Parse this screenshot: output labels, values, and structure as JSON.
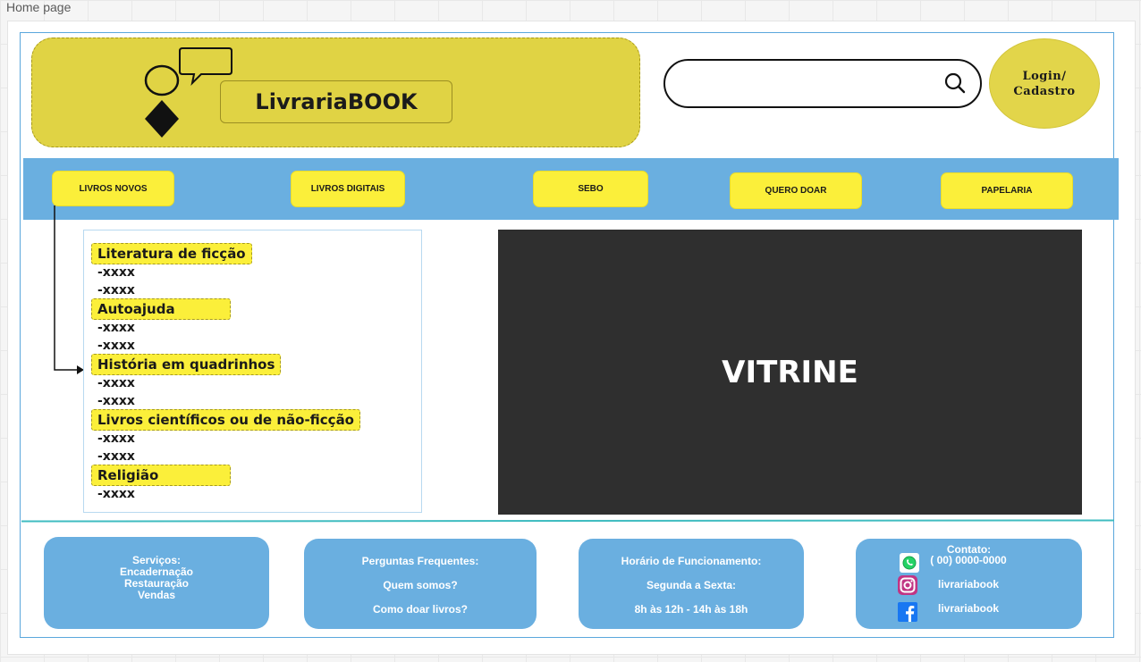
{
  "frame": {
    "label": "Home page"
  },
  "header": {
    "brand": "LivrariaBOOK",
    "search": {
      "placeholder": "",
      "value": ""
    },
    "login": {
      "line1": "Login/",
      "line2": "Cadastro"
    }
  },
  "nav": {
    "items": [
      {
        "label": "LIVROS NOVOS"
      },
      {
        "label": "LIVROS DIGITAIS"
      },
      {
        "label": "SEBO"
      },
      {
        "label": "QUERO DOAR"
      },
      {
        "label": "PAPELARIA"
      }
    ]
  },
  "categories": [
    {
      "label": "Literatura de ficção",
      "items": [
        "-xxxx",
        "-xxxx"
      ]
    },
    {
      "label": "Autoajuda",
      "items": [
        "-xxxx",
        "-xxxx"
      ]
    },
    {
      "label": "História em quadrinhos",
      "items": [
        "-xxxx",
        "-xxxx"
      ]
    },
    {
      "label": "Livros científicos ou de não-ficção",
      "items": [
        "-xxxx",
        "-xxxx"
      ]
    },
    {
      "label": "Religião",
      "items": [
        "-xxxx"
      ]
    }
  ],
  "vitrine": {
    "label": "VITRINE"
  },
  "footer": {
    "services": {
      "title": "Serviços:",
      "items": [
        "Encadernação",
        "Restauração",
        "Vendas"
      ]
    },
    "faq": {
      "title": "Perguntas Frequentes:",
      "items": [
        "Quem somos?",
        "Como doar livros?"
      ]
    },
    "hours": {
      "title": "Horário de Funcionamento:",
      "days": "Segunda a Sexta:",
      "times": "8h às 12h - 14h às 18h"
    },
    "contact": {
      "title": "Contato:",
      "phone": "( 00) 0000-0000",
      "instagram": "livrariabook",
      "facebook": "livrariabook",
      "icons": [
        "whatsapp-icon",
        "instagram-icon",
        "facebook-icon"
      ]
    }
  },
  "colors": {
    "accent_yellow": "#fbef3a",
    "logo_yellow": "#e0d344",
    "nav_blue": "#6aafe0",
    "vitrine_dark": "#2f2f2f"
  }
}
